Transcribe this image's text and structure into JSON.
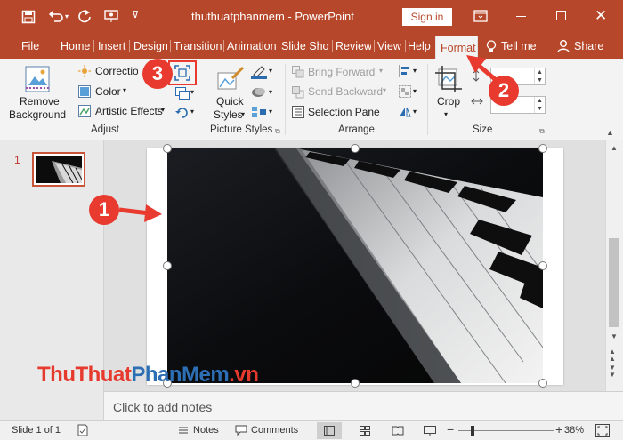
{
  "window": {
    "title": "thuthuatphanmem - PowerPoint",
    "sign_in": "Sign in"
  },
  "tabs": [
    "File",
    "Home",
    "Insert",
    "Design",
    "Transitions",
    "Animations",
    "Slide Show",
    "Review",
    "View",
    "Help",
    "Format"
  ],
  "active_tab": "Format",
  "tell_me": "Tell me",
  "share": "Share",
  "ribbon": {
    "adjust": {
      "remove_background_line1": "Remove",
      "remove_background_line2": "Background",
      "corrections": "Corrections",
      "color": "Color",
      "artistic_effects": "Artistic Effects",
      "group_label": "Adjust"
    },
    "picture_styles": {
      "quick_styles_line1": "Quick",
      "quick_styles_line2": "Styles",
      "group_label": "Picture Styles"
    },
    "arrange": {
      "bring_forward": "Bring Forward",
      "send_backward": "Send Backward",
      "selection_pane": "Selection Pane",
      "group_label": "Arrange"
    },
    "size": {
      "crop": "Crop",
      "group_label": "Size"
    }
  },
  "slides": [
    {
      "number": "1"
    }
  ],
  "notes_placeholder": "Click to add notes",
  "status": {
    "slide_info": "Slide 1 of 1",
    "notes": "Notes",
    "comments": "Comments",
    "zoom": "38%"
  },
  "annotations": [
    "1",
    "2",
    "3"
  ],
  "watermark": "ThuThuatPhanMem.vn",
  "colors": {
    "accent": "#b7472a",
    "annotation": "#e83a2e"
  }
}
